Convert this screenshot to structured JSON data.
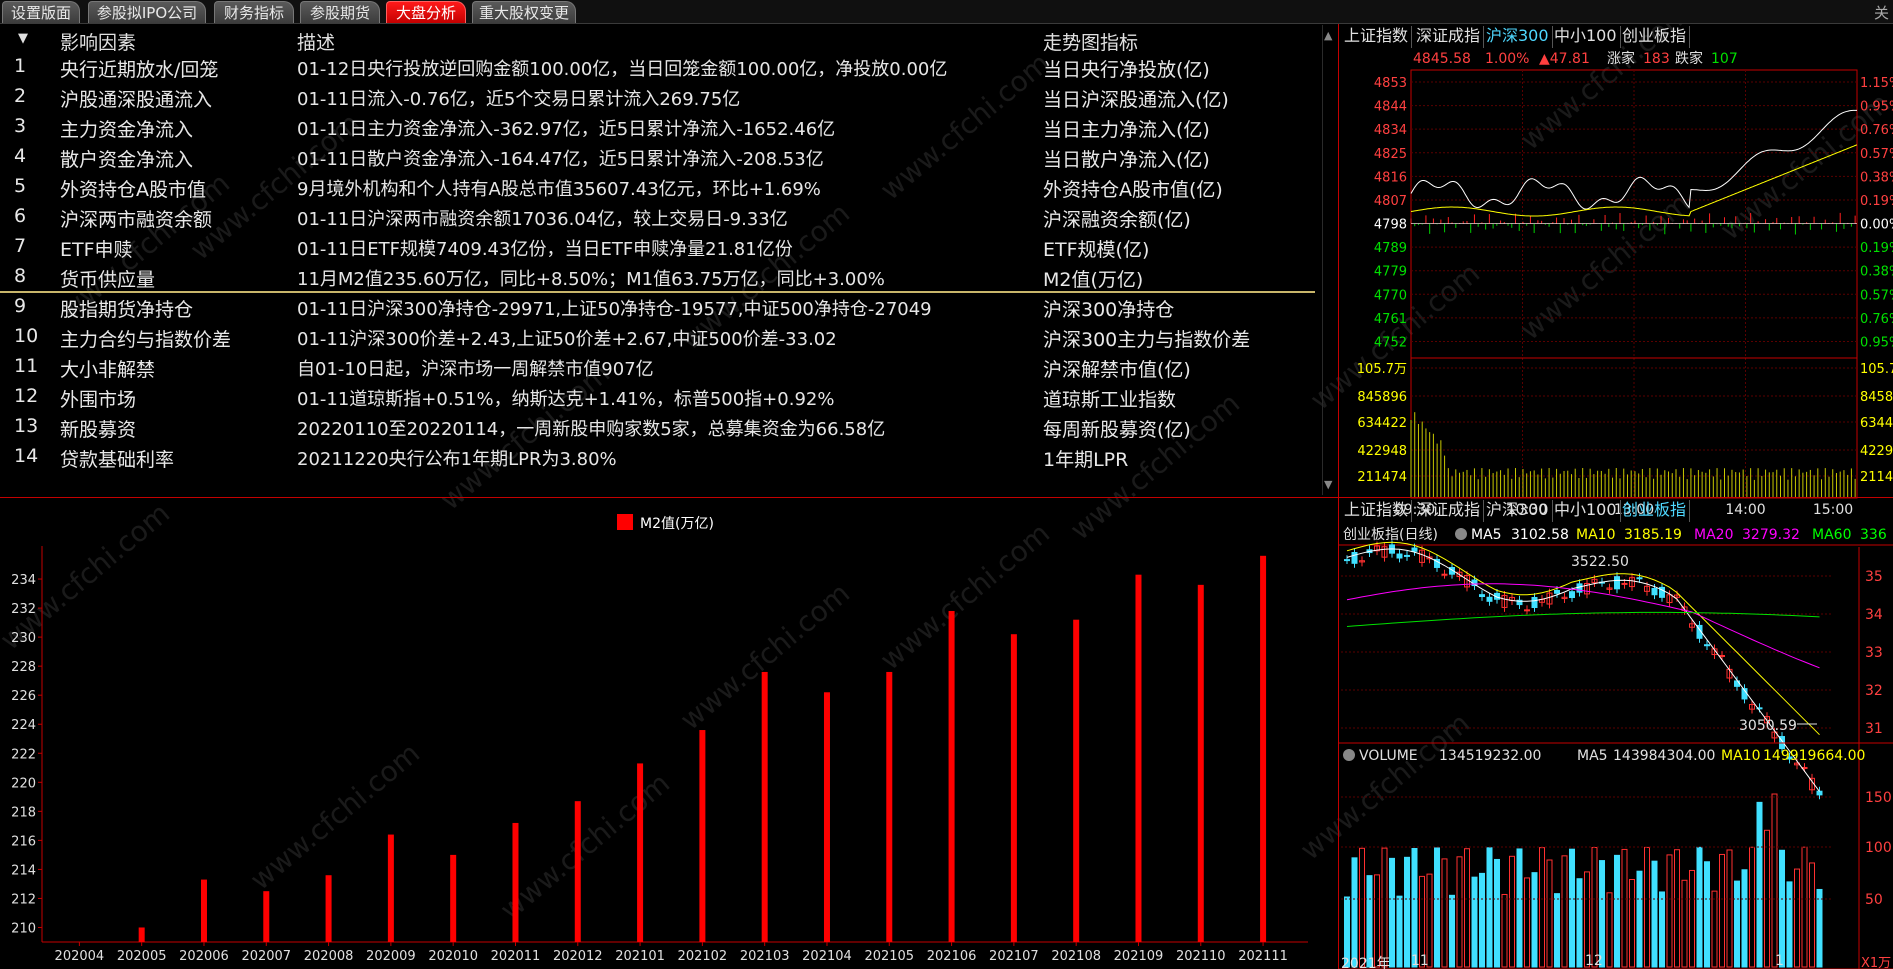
{
  "tabs": [
    "设置版面",
    "参股拟IPO公司",
    "财务指标",
    "参股期货",
    "大盘分析",
    "重大股权变更"
  ],
  "active_tab": "大盘分析",
  "table": {
    "headers": {
      "arrow": "▼",
      "factor": "影响因素",
      "desc": "描述",
      "indicator": "走势图指标"
    },
    "rows": [
      {
        "no": "1",
        "name": "央行近期放水/回笼",
        "desc": "01-12日央行投放逆回购金额100.00亿，当日回笼金额100.00亿，净投放0.00亿",
        "ind": "当日央行净投放(亿)"
      },
      {
        "no": "2",
        "name": "沪股通深股通流入",
        "desc": "01-11日流入-0.76亿，近5个交易日累计流入269.75亿",
        "ind": "当日沪深股通流入(亿)"
      },
      {
        "no": "3",
        "name": "主力资金净流入",
        "desc": "01-11日主力资金净流入-362.97亿，近5日累计净流入-1652.46亿",
        "ind": "当日主力净流入(亿)"
      },
      {
        "no": "4",
        "name": "散户资金净流入",
        "desc": "01-11日散户资金净流入-164.47亿，近5日累计净流入-208.53亿",
        "ind": "当日散户净流入(亿)"
      },
      {
        "no": "5",
        "name": "外资持仓A股市值",
        "desc": "9月境外机构和个人持有A股总市值35607.43亿元，环比+1.69%",
        "ind": "外资持仓A股市值(亿)"
      },
      {
        "no": "6",
        "name": "沪深两市融资余额",
        "desc": "01-11日沪深两市融资余额17036.04亿，较上交易日-9.33亿",
        "ind": "沪深融资余额(亿)"
      },
      {
        "no": "7",
        "name": "ETF申赎",
        "desc": "01-11日ETF规模7409.43亿份，当日ETF申赎净量21.81亿份",
        "ind": "ETF规模(亿)"
      },
      {
        "no": "8",
        "name": "货币供应量",
        "desc": "11月M2值235.60万亿，同比+8.50%；M1值63.75万亿，同比+3.00%",
        "ind": "M2值(万亿)"
      },
      {
        "no": "9",
        "name": "股指期货净持仓",
        "desc": "01-11日沪深300净持仓-29971,上证50净持仓-19577,中证500净持仓-27049",
        "ind": "沪深300净持仓"
      },
      {
        "no": "10",
        "name": "主力合约与指数价差",
        "desc": "01-11沪深300价差+2.43,上证50价差+2.67,中证500价差-33.02",
        "ind": "沪深300主力与指数价差"
      },
      {
        "no": "11",
        "name": "大小非解禁",
        "desc": "自01-10日起，沪深市场一周解禁市值907亿",
        "ind": "沪深解禁市值(亿)"
      },
      {
        "no": "12",
        "name": "外围市场",
        "desc": "01-11道琼斯指+0.51%，纳斯达克+1.41%，标普500指+0.92%",
        "ind": "道琼斯工业指数"
      },
      {
        "no": "13",
        "name": "新股募资",
        "desc": "20220110至20220114，一周新股申购家数5家，总募集资金为66.58亿",
        "ind": "每周新股募资(亿)"
      },
      {
        "no": "14",
        "name": "贷款基础利率",
        "desc": "20211220央行公布1年期LPR为3.80%",
        "ind": "1年期LPR"
      }
    ]
  },
  "chart_data": [
    {
      "type": "bar",
      "legend": [
        "M2值(万亿)"
      ],
      "categories": [
        "202004",
        "202005",
        "202006",
        "202007",
        "202008",
        "202009",
        "202010",
        "202011",
        "202012",
        "202101",
        "202102",
        "202103",
        "202104",
        "202105",
        "202106",
        "202107",
        "202108",
        "202109",
        "202110",
        "202111"
      ],
      "values": [
        209.0,
        210.0,
        213.3,
        212.5,
        213.6,
        216.4,
        215.0,
        217.2,
        218.7,
        221.3,
        223.6,
        227.6,
        226.2,
        227.6,
        231.8,
        230.2,
        231.2,
        234.3,
        233.6,
        235.6
      ],
      "ylim": [
        209,
        236
      ],
      "yticks": [
        210,
        212,
        214,
        216,
        218,
        220,
        222,
        224,
        226,
        228,
        230,
        232,
        234
      ],
      "bar_color": "#ff0000"
    },
    {
      "type": "line",
      "panel": "intraday",
      "tabs": [
        "上证指数",
        "深证成指",
        "沪深300",
        "中小100",
        "创业板指"
      ],
      "active_tab": "沪深300",
      "info": {
        "price": "4845.58",
        "pct": "1.00%",
        "chg": "▲47.81",
        "up_label": "涨家",
        "up": "183",
        "down_label": "跌家",
        "down": "107"
      },
      "y_left": [
        "4853",
        "4844",
        "4834",
        "4825",
        "4816",
        "4807",
        "4798",
        "4789",
        "4779",
        "4770",
        "4761",
        "4752"
      ],
      "y_right": [
        "1.15%",
        "0.95%",
        "0.76%",
        "0.57%",
        "0.38%",
        "0.19%",
        "0.00%",
        "0.19%",
        "0.38%",
        "0.57%",
        "0.76%",
        "0.95%"
      ],
      "vol_left": [
        "105.7万",
        "845896",
        "634422",
        "422948",
        "211474"
      ],
      "vol_right": [
        "105.7",
        "8458",
        "6344",
        "4229",
        "2114"
      ],
      "x": [
        "09:30",
        "10:30",
        "13:00",
        "14:00",
        "15:00"
      ]
    },
    {
      "type": "candlestick",
      "panel": "daily",
      "tabs": [
        "上证指数",
        "深证成指",
        "沪深300",
        "中小100",
        "创业板指"
      ],
      "active_tab": "创业板指",
      "title": "创业板指(日线)",
      "ma": [
        {
          "name": "MA5",
          "value": "3102.58",
          "color": "#ffffff"
        },
        {
          "name": "MA10",
          "value": "3185.19",
          "color": "#ffff00"
        },
        {
          "name": "MA20",
          "value": "3279.32",
          "color": "#ff00ff"
        },
        {
          "name": "MA60",
          "value": "336",
          "color": "#00ff00"
        }
      ],
      "high_label": "3522.50",
      "low_label": "3050.59",
      "y_right": [
        "35",
        "34",
        "33",
        "32",
        "31"
      ],
      "volume": {
        "title": "VOLUME",
        "value": "134519232.00",
        "ma5_label": "MA5",
        "ma5": "143984304.00",
        "ma10_label": "MA10",
        "ma10": "149919664.00",
        "y_right": [
          "150",
          "100",
          "50"
        ],
        "unit": "X1万"
      },
      "x": [
        "2021年",
        "11",
        "12",
        "1"
      ]
    }
  ],
  "watermark": "www.cfchi.com"
}
